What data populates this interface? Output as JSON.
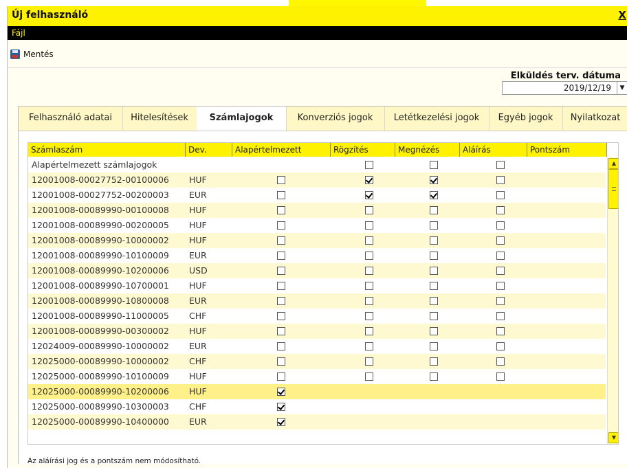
{
  "window": {
    "title": "Új felhasználó",
    "close_label": "X"
  },
  "menu": {
    "file": "Fájl"
  },
  "toolbar": {
    "save_label": "Mentés"
  },
  "send_date": {
    "label": "Elküldés terv. dátuma",
    "value": "2019/12/19"
  },
  "tabs": [
    {
      "label": "Felhasználó adatai",
      "active": false
    },
    {
      "label": "Hitelesítések",
      "active": false
    },
    {
      "label": "Számlajogok",
      "active": true
    },
    {
      "label": "Konverziós jogok",
      "active": false
    },
    {
      "label": "Letétkezelési jogok",
      "active": false
    },
    {
      "label": "Egyéb jogok",
      "active": false
    },
    {
      "label": "Nyilatkozat",
      "active": false
    }
  ],
  "table": {
    "columns": [
      "Számlaszám",
      "Dev.",
      "Alapértelmezett",
      "Rögzítés",
      "Megnézés",
      "Aláírás",
      "Pontszám"
    ],
    "rows": [
      {
        "account": "Alapértelmezett számlajogok",
        "currency": "",
        "default": null,
        "record": false,
        "view": false,
        "sign": false
      },
      {
        "account": "12001008-00027752-00100006",
        "currency": "HUF",
        "default": false,
        "record": true,
        "view": true,
        "sign": false
      },
      {
        "account": "12001008-00027752-00200003",
        "currency": "EUR",
        "default": false,
        "record": true,
        "view": true,
        "sign": false
      },
      {
        "account": "12001008-00089990-00100008",
        "currency": "HUF",
        "default": false,
        "record": false,
        "view": false,
        "sign": false
      },
      {
        "account": "12001008-00089990-00200005",
        "currency": "HUF",
        "default": false,
        "record": false,
        "view": false,
        "sign": false
      },
      {
        "account": "12001008-00089990-10000002",
        "currency": "HUF",
        "default": false,
        "record": false,
        "view": false,
        "sign": false
      },
      {
        "account": "12001008-00089990-10100009",
        "currency": "EUR",
        "default": false,
        "record": false,
        "view": false,
        "sign": false
      },
      {
        "account": "12001008-00089990-10200006",
        "currency": "USD",
        "default": false,
        "record": false,
        "view": false,
        "sign": false
      },
      {
        "account": "12001008-00089990-10700001",
        "currency": "HUF",
        "default": false,
        "record": false,
        "view": false,
        "sign": false
      },
      {
        "account": "12001008-00089990-10800008",
        "currency": "EUR",
        "default": false,
        "record": false,
        "view": false,
        "sign": false
      },
      {
        "account": "12001008-00089990-11000005",
        "currency": "CHF",
        "default": false,
        "record": false,
        "view": false,
        "sign": false
      },
      {
        "account": "12001008-00089990-00300002",
        "currency": "HUF",
        "default": false,
        "record": false,
        "view": false,
        "sign": false
      },
      {
        "account": "12024009-00089990-10000002",
        "currency": "EUR",
        "default": false,
        "record": false,
        "view": false,
        "sign": false
      },
      {
        "account": "12025000-00089990-10000002",
        "currency": "CHF",
        "default": false,
        "record": false,
        "view": false,
        "sign": false
      },
      {
        "account": "12025000-00089990-10100009",
        "currency": "HUF",
        "default": false,
        "record": false,
        "view": false,
        "sign": false
      },
      {
        "account": "12025000-00089990-10200006",
        "currency": "HUF",
        "default": true,
        "record": null,
        "view": null,
        "sign": null
      },
      {
        "account": "12025000-00089990-10300003",
        "currency": "CHF",
        "default": true,
        "record": null,
        "view": null,
        "sign": null
      },
      {
        "account": "12025000-00089990-10400000",
        "currency": "EUR",
        "default": true,
        "record": null,
        "view": null,
        "sign": null
      }
    ]
  },
  "note": "Az aláírási jog és a pontszám nem módosítható.",
  "colors": {
    "accent_yellow": "#fff200",
    "menubar": "#000000",
    "row_alt": "#fff9d2"
  }
}
